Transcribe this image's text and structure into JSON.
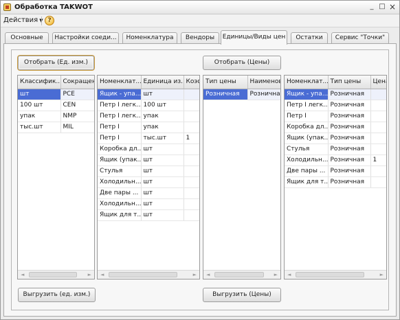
{
  "window": {
    "title": "Обработка  TAKWOT",
    "minimize": "_",
    "maximize": "□",
    "close": "×"
  },
  "toolbar": {
    "actions_label": "Действия",
    "help_label": "?"
  },
  "tabs": [
    {
      "label": "Основные"
    },
    {
      "label": "Настройки соеди..."
    },
    {
      "label": "Номенклатура"
    },
    {
      "label": "Вендоры"
    },
    {
      "label": "Единицы/Виды цен"
    },
    {
      "label": "Остатки"
    },
    {
      "label": "Сервис \"Точки\""
    }
  ],
  "active_tab": "Единицы/Виды цен",
  "buttons": {
    "select_units": "Отобрать (Ед. изм.)",
    "select_prices": "Отобрать (Цены)",
    "upload_units": "Выгрузить (ед. изм.)",
    "upload_prices": "Выгрузить (Цены)"
  },
  "units_grid": {
    "columns": [
      "Классифик...",
      "Сокращенн..."
    ],
    "rows": [
      [
        "шт",
        "PCE"
      ],
      [
        "100 шт",
        "CEN"
      ],
      [
        "упак",
        "NMP"
      ],
      [
        "тыс.шт",
        "MIL"
      ]
    ]
  },
  "items_units_grid": {
    "columns": [
      "Номенклат...",
      "Единица из...",
      "Коэф"
    ],
    "rows": [
      [
        "Ящик - упа...",
        "шт",
        ""
      ],
      [
        "Петр I легк...",
        "100 шт",
        ""
      ],
      [
        "Петр I легк...",
        "упак",
        ""
      ],
      [
        "Петр I",
        "упак",
        ""
      ],
      [
        "Петр I",
        "тыс.шт",
        "1"
      ],
      [
        "Коробка дл...",
        "шт",
        ""
      ],
      [
        "Ящик (упак...",
        "шт",
        ""
      ],
      [
        "Стулья",
        "шт",
        ""
      ],
      [
        "Холодильн...",
        "шт",
        ""
      ],
      [
        "Две пары ...",
        "шт",
        ""
      ],
      [
        "Холодильн...",
        "шт",
        ""
      ],
      [
        "Ящик для т...",
        "шт",
        ""
      ]
    ]
  },
  "price_types_grid": {
    "columns": [
      "Тип цены",
      "Наименова"
    ],
    "rows": [
      [
        "Розничная",
        "Розничная"
      ]
    ]
  },
  "items_prices_grid": {
    "columns": [
      "Номенклат...",
      "Тип цены",
      "Цена"
    ],
    "rows": [
      [
        "Ящик - упа...",
        "Розничная",
        ""
      ],
      [
        "Петр I легк...",
        "Розничная",
        ""
      ],
      [
        "Петр I",
        "Розничная",
        ""
      ],
      [
        "Коробка дл...",
        "Розничная",
        ""
      ],
      [
        "Ящик (упак...",
        "Розничная",
        ""
      ],
      [
        "Стулья",
        "Розничная",
        ""
      ],
      [
        "Холодильн...",
        "Розничная",
        "1"
      ],
      [
        "Две пары ...",
        "Розничная",
        ""
      ],
      [
        "Ящик для т...",
        "Розничная",
        ""
      ]
    ]
  },
  "colors": {
    "selection": "#4a6cd4",
    "window_bg": "#ececec",
    "panel_bg": "#f7f7f7"
  }
}
